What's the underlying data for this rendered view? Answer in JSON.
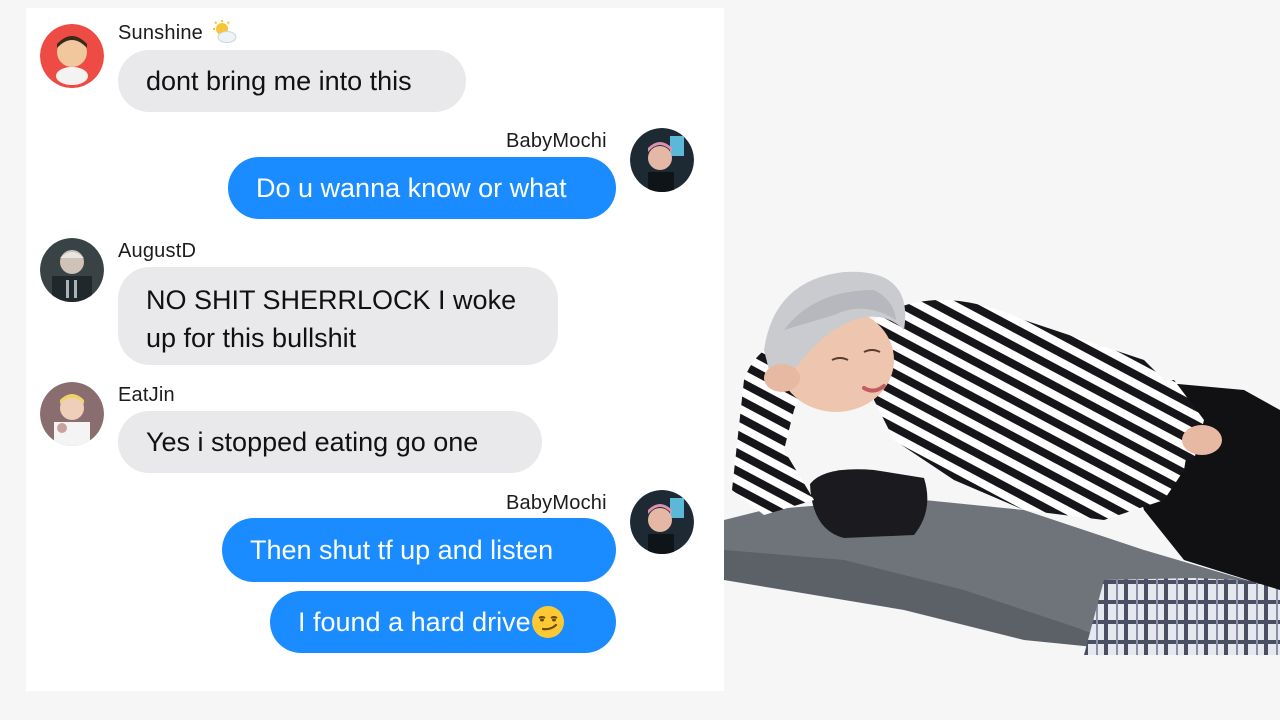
{
  "messages": [
    {
      "sender": "Sunshine",
      "sender_emoji": "sun-behind-cloud-icon",
      "text": "dont bring me into this",
      "direction": "incoming"
    },
    {
      "sender": "BabyMochi",
      "text": "Do u wanna know or what",
      "direction": "outgoing"
    },
    {
      "sender": "AugustD",
      "text": "NO SHIT SHERRLOCK I woke up for this bullshit",
      "direction": "incoming"
    },
    {
      "sender": "EatJin",
      "text": "Yes i stopped eating go one",
      "direction": "incoming"
    },
    {
      "sender": "BabyMochi",
      "text": "Then shut tf up and listen",
      "direction": "outgoing"
    },
    {
      "sender": "BabyMochi",
      "text": "I found a hard drive",
      "emoji": "smirk-face-icon",
      "direction": "outgoing"
    }
  ],
  "colors": {
    "outgoing_bubble": "#1a8cff",
    "incoming_bubble": "#e9e9eb",
    "background": "#f6f6f7"
  }
}
